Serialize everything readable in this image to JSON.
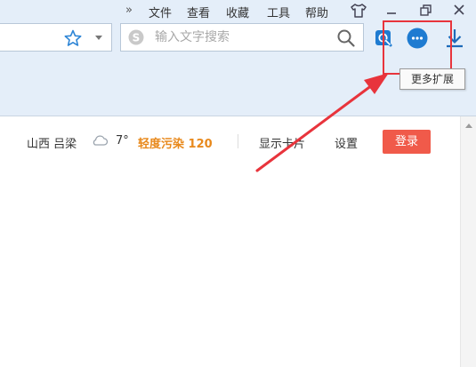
{
  "menu": {
    "items": [
      "文件",
      "查看",
      "收藏",
      "工具",
      "帮助"
    ],
    "overflow_icon": "double-chevron-right-icon"
  },
  "window_controls": [
    "minimize-icon",
    "restore-icon",
    "close-icon"
  ],
  "search": {
    "placeholder": "输入文字搜索",
    "value": ""
  },
  "toolbar_icons": [
    "favorite-star-icon",
    "dropdown-arrow-icon",
    "sogou-logo-icon",
    "search-icon",
    "screenshot-icon",
    "more-extensions-icon",
    "download-icon"
  ],
  "tooltip": {
    "text": "更多扩展"
  },
  "content": {
    "location": "山西 吕梁",
    "temperature": "7°",
    "air_quality": "轻度污染 120",
    "show_cards": "显示卡片",
    "settings": "设置",
    "login": "登录"
  },
  "colors": {
    "chrome_bg": "#e4eef9",
    "accent_blue": "#1e7bd1",
    "annotation_red": "#e8343c",
    "login_red": "#f05a4a",
    "aqi_orange": "#e8891c"
  }
}
